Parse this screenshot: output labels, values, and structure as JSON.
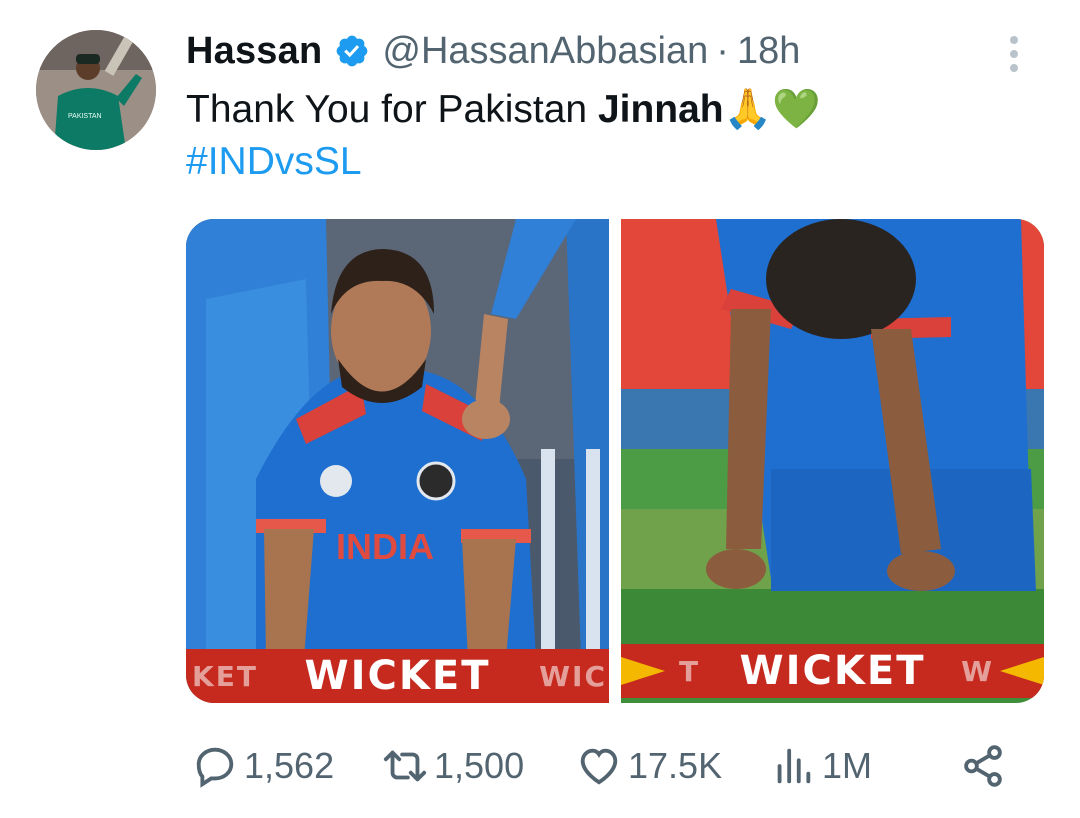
{
  "author": {
    "display_name": "Hassan",
    "handle": "@HassanAbbasian",
    "time": "18h",
    "verified": true,
    "avatar_jersey_text": "PAKISTAN"
  },
  "tweet": {
    "text_prefix": "Thank You for Pakistan ",
    "text_bold": "Jinnah",
    "emojis": "🙏💚",
    "hashtag": "#INDvsSL"
  },
  "media": [
    {
      "banner_left": "KET",
      "banner_main": "WICKET",
      "banner_right": "WIC",
      "jersey_text": "INDIA"
    },
    {
      "banner_left": "T",
      "banner_main": "WICKET",
      "banner_right": "W"
    }
  ],
  "actions": {
    "replies": "1,562",
    "retweets": "1,500",
    "likes": "17.5K",
    "views": "1M"
  },
  "colors": {
    "link": "#1d9bf0",
    "secondary": "#536471",
    "verified": "#1d9bf0",
    "jersey_blue": "#1e6fd0",
    "banner_red": "#c62a1f",
    "grass": "#3f8f3a"
  },
  "icons": [
    "verified-icon",
    "more-icon",
    "reply-icon",
    "retweet-icon",
    "like-icon",
    "views-icon",
    "share-icon"
  ]
}
